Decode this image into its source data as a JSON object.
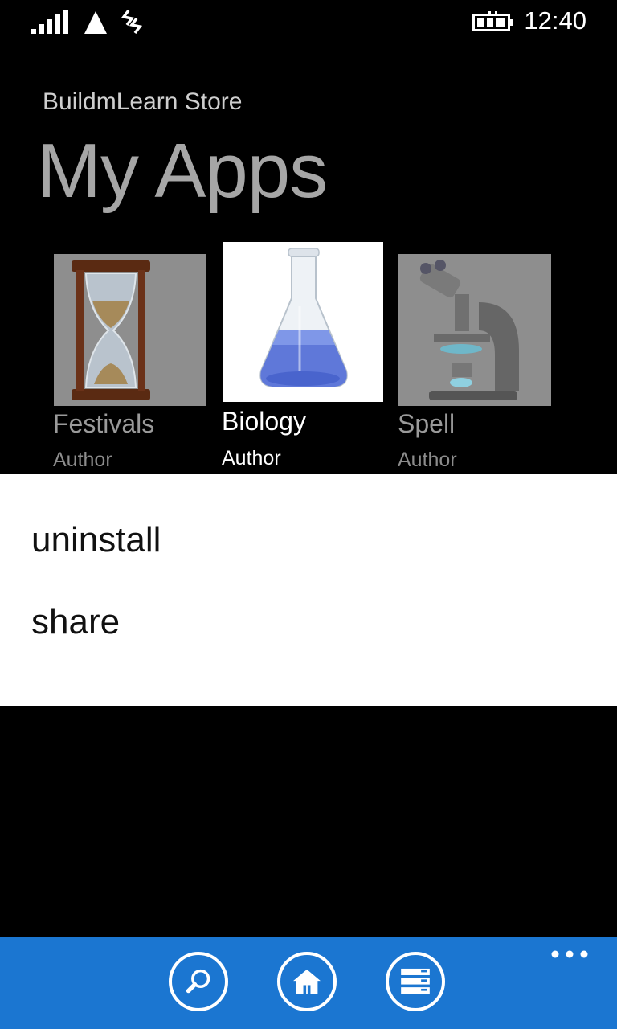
{
  "status_bar": {
    "time": "12:40",
    "icons": [
      "signal-strength-icon",
      "data-connection-icon",
      "wifi-icon",
      "battery-charging-icon"
    ]
  },
  "header": {
    "app_name": "BuildmLearn Store",
    "page_title": "My Apps"
  },
  "apps": [
    {
      "title": "Festivals",
      "author": "Author",
      "icon": "hourglass-icon",
      "selected": false
    },
    {
      "title": "Biology",
      "author": "Author",
      "icon": "flask-icon",
      "selected": true
    },
    {
      "title": "Spell",
      "author": "Author",
      "icon": "microscope-icon",
      "selected": false
    }
  ],
  "context_menu": {
    "items": [
      {
        "label": "uninstall"
      },
      {
        "label": "share"
      }
    ]
  },
  "app_bar": {
    "buttons": [
      "search-icon",
      "home-icon",
      "list-icon"
    ],
    "more": "more-options-icon"
  },
  "colors": {
    "app_bar": "#1b76d1",
    "background": "#000000",
    "menu_background": "#ffffff"
  }
}
